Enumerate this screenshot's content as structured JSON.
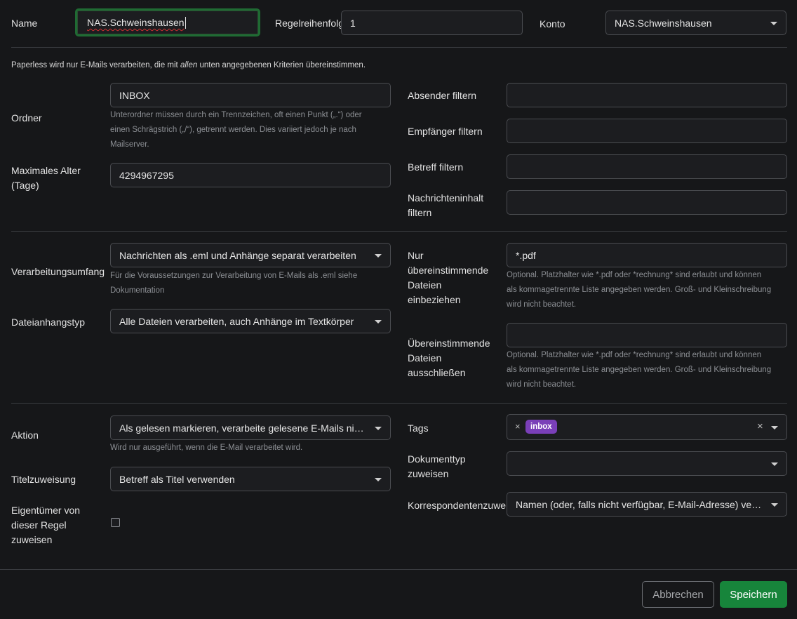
{
  "header": {
    "name_label": "Name",
    "name_value": "NAS.Schweinshausen",
    "order_label": "Regelreihenfolge",
    "order_value": "1",
    "account_label": "Konto",
    "account_value": "NAS.Schweinshausen"
  },
  "intro": {
    "before": "Paperless wird nur E-Mails verarbeiten, die mit ",
    "emphasis": "allen",
    "after": " unten angegebenen Kriterien übereinstimmen."
  },
  "section1": {
    "folder_label": "Ordner",
    "folder_value": "INBOX",
    "folder_help": [
      "Unterordner müssen durch ein Trennzeichen, oft einen Punkt („.“) oder",
      "einen Schrägstrich („/“), getrennt werden. Dies variiert jedoch je nach",
      "Mailserver."
    ],
    "max_age_label": [
      "Maximales Alter",
      "(Tage)"
    ],
    "max_age_value": "4294967295",
    "filter_from_label": "Absender filtern",
    "filter_from_value": "",
    "filter_to_label": "Empfänger filtern",
    "filter_to_value": "",
    "filter_subject_label": "Betreff filtern",
    "filter_subject_value": "",
    "filter_body_label": [
      "Nachrichteninhalt",
      "filtern"
    ],
    "filter_body_value": ""
  },
  "section2": {
    "scope_label": "Verarbeitungsumfang",
    "scope_value": "Nachrichten als .eml und Anhänge separat verarbeiten",
    "scope_help": [
      "Für die Voraussetzungen zur Verarbeitung von E-Mails als .eml siehe",
      "Dokumentation"
    ],
    "attachment_type_label": "Dateianhangstyp",
    "attachment_type_value": "Alle Dateien verarbeiten, auch Anhänge im Textkörper",
    "include_label": [
      "Nur",
      "übereinstimmende",
      "Dateien",
      "einbeziehen"
    ],
    "include_value": "*.pdf",
    "include_help": [
      "Optional. Platzhalter wie *.pdf oder *rechnung* sind erlaubt und können",
      "als kommagetrennte Liste angegeben werden. Groß- und Kleinschreibung",
      "wird nicht beachtet."
    ],
    "exclude_label": [
      "Übereinstimmende",
      "Dateien",
      "ausschließen"
    ],
    "exclude_value": "",
    "exclude_help": [
      "Optional. Platzhalter wie *.pdf oder *rechnung* sind erlaubt und können",
      "als kommagetrennte Liste angegeben werden. Groß- und Kleinschreibung",
      "wird nicht beachtet."
    ]
  },
  "section3": {
    "action_label": "Aktion",
    "action_value": "Als gelesen markieren, verarbeite gelesene E-Mails nicht",
    "action_help": "Wird nur ausgeführt, wenn die E-Mail verarbeitet wird.",
    "title_label": "Titelzuweisung",
    "title_value": "Betreff als Titel verwenden",
    "owner_label": [
      "Eigentümer von",
      "dieser Regel",
      "zuweisen"
    ],
    "owner_checked": false,
    "tags_label": "Tags",
    "tags": [
      {
        "label": "inbox",
        "color": "#7a3fb8"
      }
    ],
    "tag_remove_glyph": "×",
    "tags_clear_glyph": "×",
    "doctype_label": [
      "Dokumenttyp",
      "zuweisen"
    ],
    "doctype_value": "",
    "correspondent_label": "Korrespondentenzuweisung",
    "correspondent_value": "Namen (oder, falls nicht verfügbar, E-Mail-Adresse) verwenden"
  },
  "footer": {
    "cancel_label": "Abbrechen",
    "save_label": "Speichern"
  },
  "colors": {
    "background": "#161719",
    "input_border": "#4a4c50",
    "focus_border": "#1f6b33",
    "primary": "#17853b",
    "tag": "#7a3fb8"
  }
}
